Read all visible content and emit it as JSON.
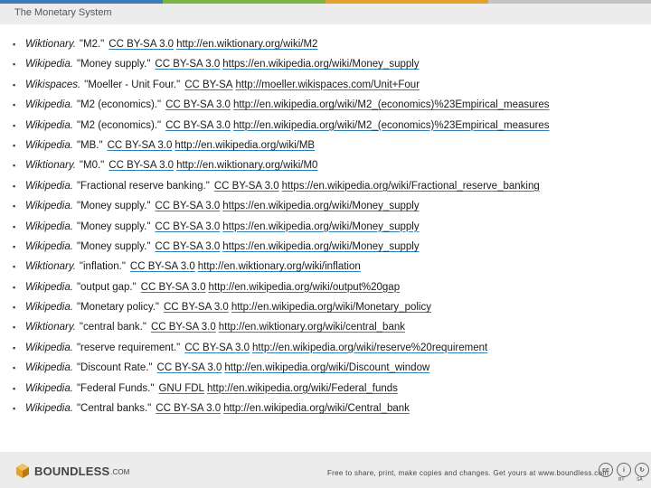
{
  "colors": {
    "bar": [
      "#3a7cb8",
      "#7ab542",
      "#e3a12f",
      "#c4c4c4"
    ],
    "link_underline": "#2e7fb8"
  },
  "header": {
    "title": "The Monetary System"
  },
  "references": [
    {
      "source": "Wiktionary.",
      "title": "\"M2.\"",
      "license": "CC BY-SA 3.0",
      "url": "http://en.wiktionary.org/wiki/M2"
    },
    {
      "source": "Wikipedia.",
      "title": "\"Money supply.\"",
      "license": "CC BY-SA 3.0",
      "url": "https://en.wikipedia.org/wiki/Money_supply"
    },
    {
      "source": "Wikispaces.",
      "title": "\"Moeller - Unit Four.\"",
      "license": "CC BY-SA",
      "url": "http://moeller.wikispaces.com/Unit+Four"
    },
    {
      "source": "Wikipedia.",
      "title": "\"M2 (economics).\"",
      "license": "CC BY-SA 3.0",
      "url": "http://en.wikipedia.org/wiki/M2_(economics)%23Empirical_measures"
    },
    {
      "source": "Wikipedia.",
      "title": "\"M2 (economics).\"",
      "license": "CC BY-SA 3.0",
      "url": "http://en.wikipedia.org/wiki/M2_(economics)%23Empirical_measures"
    },
    {
      "source": "Wikipedia.",
      "title": "\"MB.\"",
      "license": "CC BY-SA 3.0",
      "url": "http://en.wikipedia.org/wiki/MB"
    },
    {
      "source": "Wiktionary.",
      "title": "\"M0.\"",
      "license": "CC BY-SA 3.0",
      "url": "http://en.wiktionary.org/wiki/M0"
    },
    {
      "source": "Wikipedia.",
      "title": "\"Fractional reserve banking.\"",
      "license": "CC BY-SA 3.0",
      "url": "https://en.wikipedia.org/wiki/Fractional_reserve_banking"
    },
    {
      "source": "Wikipedia.",
      "title": "\"Money supply.\"",
      "license": "CC BY-SA 3.0",
      "url": "https://en.wikipedia.org/wiki/Money_supply"
    },
    {
      "source": "Wikipedia.",
      "title": "\"Money supply.\"",
      "license": "CC BY-SA 3.0",
      "url": "https://en.wikipedia.org/wiki/Money_supply"
    },
    {
      "source": "Wikipedia.",
      "title": "\"Money supply.\"",
      "license": "CC BY-SA 3.0",
      "url": "https://en.wikipedia.org/wiki/Money_supply"
    },
    {
      "source": "Wiktionary.",
      "title": "\"inflation.\"",
      "license": "CC BY-SA 3.0",
      "url": "http://en.wiktionary.org/wiki/inflation"
    },
    {
      "source": "Wikipedia.",
      "title": "\"output gap.\"",
      "license": "CC BY-SA 3.0",
      "url": "http://en.wikipedia.org/wiki/output%20gap"
    },
    {
      "source": "Wikipedia.",
      "title": "\"Monetary policy.\"",
      "license": "CC BY-SA 3.0",
      "url": "http://en.wikipedia.org/wiki/Monetary_policy"
    },
    {
      "source": "Wiktionary.",
      "title": "\"central bank.\"",
      "license": "CC BY-SA 3.0",
      "url": "http://en.wiktionary.org/wiki/central_bank"
    },
    {
      "source": "Wikipedia.",
      "title": "\"reserve requirement.\"",
      "license": "CC BY-SA 3.0",
      "url": "http://en.wikipedia.org/wiki/reserve%20requirement"
    },
    {
      "source": "Wikipedia.",
      "title": "\"Discount Rate.\"",
      "license": "CC BY-SA 3.0",
      "url": "http://en.wikipedia.org/wiki/Discount_window"
    },
    {
      "source": "Wikipedia.",
      "title": "\"Federal Funds.\"",
      "license": "GNU FDL",
      "url": "http://en.wikipedia.org/wiki/Federal_funds"
    },
    {
      "source": "Wikipedia.",
      "title": "\"Central banks.\"",
      "license": "CC BY-SA 3.0",
      "url": "http://en.wikipedia.org/wiki/Central_bank"
    }
  ],
  "footer": {
    "logo_text": "BOUNDLESS",
    "logo_suffix": ".COM",
    "logo_icon": "boundless-logo-icon",
    "tagline": "Free to share, print, make copies and changes. Get yours at www.boundless.com",
    "cc_badges": [
      "cc",
      "i",
      "↻"
    ],
    "cc_labels": [
      "BY",
      "SA"
    ]
  }
}
